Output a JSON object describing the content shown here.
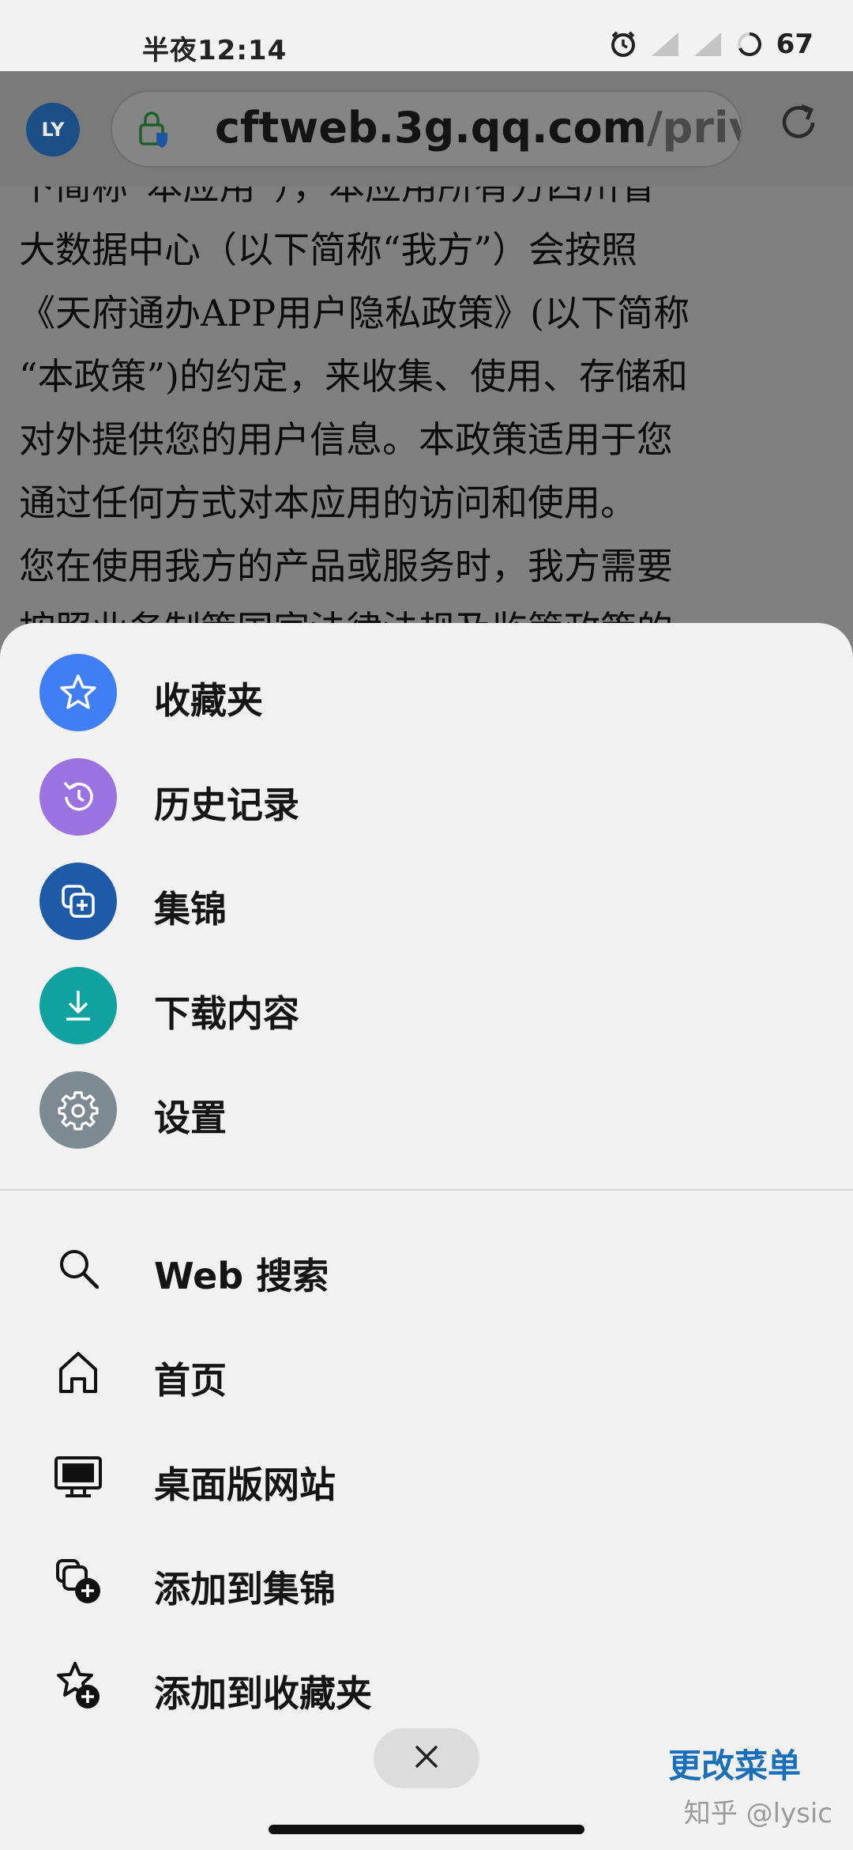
{
  "status_bar": {
    "time": "半夜12:14",
    "battery": "67",
    "icons": [
      "alarm-icon",
      "signal-icon",
      "signal-icon",
      "battery-ring-icon"
    ]
  },
  "toolbar": {
    "avatar_initials": "LY",
    "url_domain": "cftweb.3g.qq.com",
    "url_path": "/privac",
    "lock_icon": "lock-shield-icon",
    "refresh_icon": "refresh-icon"
  },
  "page": {
    "lines": [
      "下简称“本应用”），本应用所有方四川省",
      "大数据中心（以下简称“我方”）会按照",
      "《天府通办APP用户隐私政策》(以下简称",
      "“本政策”)的约定，来收集、使用、存储和",
      "对外提供您的用户信息。本政策适用于您",
      "通过任何方式对本应用的访问和使用。",
      "您在使用我方的产品或服务时，我方需要",
      "按照业务制策国家法律法规及监管政策的"
    ]
  },
  "menu": {
    "primary": [
      {
        "label": "收藏夹",
        "icon": "star-icon",
        "color": "#3f7ef5"
      },
      {
        "label": "历史记录",
        "icon": "history-icon",
        "color": "#9b73e0"
      },
      {
        "label": "集锦",
        "icon": "collections-icon",
        "color": "#1e5aa8"
      },
      {
        "label": "下载内容",
        "icon": "download-icon",
        "color": "#0fa2a0"
      },
      {
        "label": "设置",
        "icon": "gear-icon",
        "color": "#7d8a92"
      }
    ],
    "secondary": [
      {
        "label": "Web 搜索",
        "icon": "search-icon"
      },
      {
        "label": "首页",
        "icon": "home-icon"
      },
      {
        "label": "桌面版网站",
        "icon": "desktop-icon"
      },
      {
        "label": "添加到集锦",
        "icon": "add-to-collections-icon"
      },
      {
        "label": "添加到收藏夹",
        "icon": "add-to-favorites-icon"
      }
    ],
    "change_menu_label": "更改菜单",
    "close_icon": "close-icon"
  },
  "watermark": "知乎 @lysic"
}
